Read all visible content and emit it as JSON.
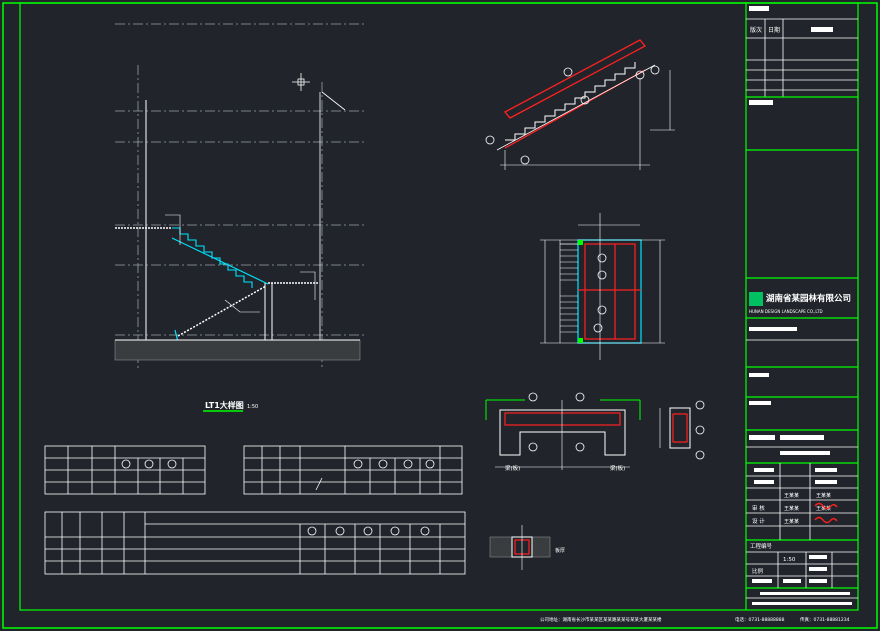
{
  "title_block": {
    "company_name": "湖南省某园林有限公司",
    "company_name_en": "HUNAN DESIGN LANDSCAPE CO.,LTD",
    "header_col1": "版次",
    "header_col2": "日期",
    "role_review": "审 核",
    "role_design": "设 计",
    "name_1": "王某某",
    "name_2": "王某某",
    "scale_label": "比例",
    "scale_value": "1:50",
    "project_no_label": "工程编号"
  },
  "drawing": {
    "main_title": "LT1大样图",
    "main_scale": "1:50",
    "label_left_section": "梁(板)",
    "label_right_section": "梁(板)",
    "edge_label": "板厚"
  },
  "footer": {
    "address": "公司地址：湖南省长沙市某某区某某路某某号某某大厦某某楼",
    "phone": "电话：0731-88888888",
    "fax": "传真：0731-88881234"
  },
  "colors": {
    "background": "#21252b",
    "frame": "#00ff00",
    "line": "#ffffff",
    "rebar": "#ff2020",
    "stair": "#00e5ff",
    "grid": "#9aa0a6"
  }
}
